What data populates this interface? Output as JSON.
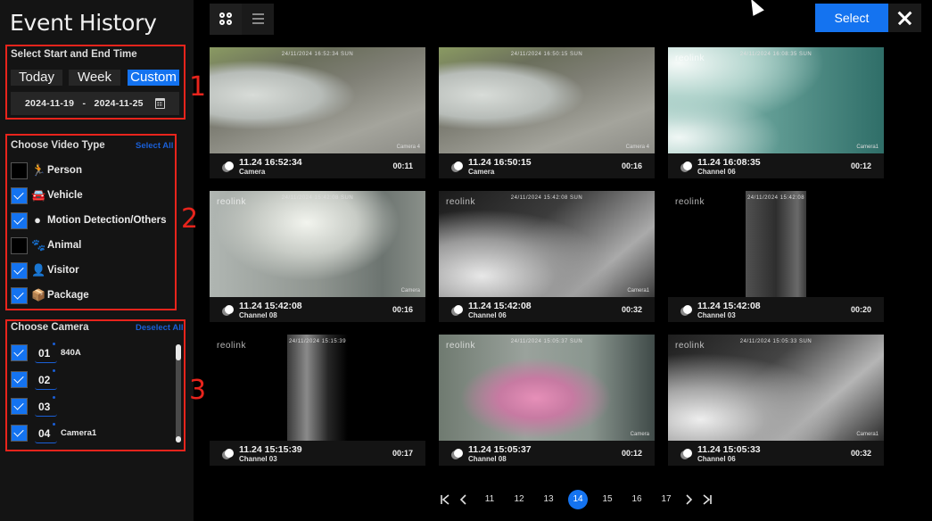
{
  "header": {
    "title": "Event History",
    "select_label": "Select",
    "view_modes": [
      "grid-view",
      "list-view"
    ],
    "active_view": "grid-view"
  },
  "time_filter": {
    "title": "Select Start and End Time",
    "ranges": [
      "Today",
      "Week",
      "Custom"
    ],
    "active_range": "Custom",
    "date_range": "2024-11-19   -   2024-11-25",
    "annotation": "1"
  },
  "video_type": {
    "title": "Choose Video Type",
    "action_label": "Select All",
    "annotation": "2",
    "items": [
      {
        "label": "Person",
        "icon": "person-running-icon",
        "glyph": "🏃",
        "checked": false
      },
      {
        "label": "Vehicle",
        "icon": "car-icon",
        "glyph": "🚘",
        "checked": true
      },
      {
        "label": "Motion Detection/Others",
        "icon": "motion-icon",
        "glyph": "●",
        "checked": true
      },
      {
        "label": "Animal",
        "icon": "paw-icon",
        "glyph": "🐾",
        "checked": false
      },
      {
        "label": "Visitor",
        "icon": "visitor-icon",
        "glyph": "👤",
        "checked": true
      },
      {
        "label": "Package",
        "icon": "package-icon",
        "glyph": "📦",
        "checked": true
      }
    ]
  },
  "cameras": {
    "title": "Choose Camera",
    "action_label": "Deselect All",
    "annotation": "3",
    "items": [
      {
        "number": "01",
        "name": "840A",
        "checked": true
      },
      {
        "number": "02",
        "name": "",
        "checked": true
      },
      {
        "number": "03",
        "name": "",
        "checked": true
      },
      {
        "number": "04",
        "name": "Camera1",
        "checked": true
      }
    ]
  },
  "events": [
    {
      "time": "11.24 16:52:34",
      "channel": "Camera",
      "duration": "00:11",
      "brand": "",
      "cam_osd": "Camera 4",
      "osd_date": "24/11/2024 16:52:34 SUN"
    },
    {
      "time": "11.24 16:50:15",
      "channel": "Camera",
      "duration": "00:16",
      "brand": "",
      "cam_osd": "Camera 4",
      "osd_date": "24/11/2024 16:50:15 SUN"
    },
    {
      "time": "11.24 16:08:35",
      "channel": "Channel 06",
      "duration": "00:12",
      "brand": "reolink",
      "cam_osd": "Camera1",
      "osd_date": "24/11/2024 16:08:35 SUN"
    },
    {
      "time": "11.24 15:42:08",
      "channel": "Channel 08",
      "duration": "00:16",
      "brand": "reolink",
      "cam_osd": "Camera",
      "osd_date": "24/11/2024 15:42:08 SUN"
    },
    {
      "time": "11.24 15:42:08",
      "channel": "Channel 06",
      "duration": "00:32",
      "brand": "reolink",
      "cam_osd": "Camera1",
      "osd_date": "24/11/2024 15:42:08 SUN"
    },
    {
      "time": "11.24 15:42:08",
      "channel": "Channel 03",
      "duration": "00:20",
      "brand": "reolink",
      "cam_osd": "",
      "osd_date": "24/11/2024 15:42:08"
    },
    {
      "time": "11.24 15:15:39",
      "channel": "Channel 03",
      "duration": "00:17",
      "brand": "reolink",
      "cam_osd": "",
      "osd_date": "24/11/2024 15:15:39"
    },
    {
      "time": "11.24 15:05:37",
      "channel": "Channel 08",
      "duration": "00:12",
      "brand": "reolink",
      "cam_osd": "Camera",
      "osd_date": "24/11/2024 15:05:37 SUN"
    },
    {
      "time": "11.24 15:05:33",
      "channel": "Channel 06",
      "duration": "00:32",
      "brand": "reolink",
      "cam_osd": "Camera1",
      "osd_date": "24/11/2024 15:05:33 SUN"
    }
  ],
  "pagination": {
    "first": "K",
    "prev": "‹",
    "pages": [
      "11",
      "12",
      "13",
      "14",
      "15",
      "16",
      "17"
    ],
    "current": "14",
    "next": "›",
    "last": "›|"
  },
  "colors": {
    "accent": "#1473f0",
    "link": "#1a5fd6",
    "annotation": "#e8241c",
    "sidebar_bg": "#141414"
  }
}
